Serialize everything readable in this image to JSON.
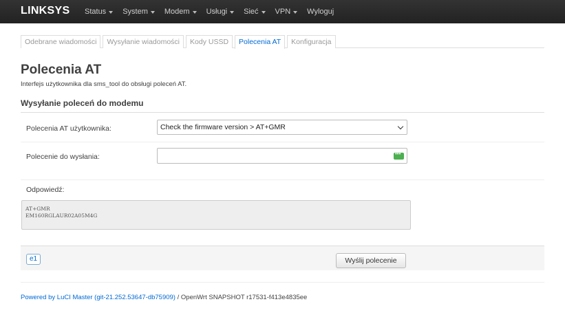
{
  "navbar": {
    "brand": "LINKSYS",
    "menu": [
      {
        "label": "Status",
        "dropdown": true
      },
      {
        "label": "System",
        "dropdown": true
      },
      {
        "label": "Modem",
        "dropdown": true
      },
      {
        "label": "Usługi",
        "dropdown": true
      },
      {
        "label": "Sieć",
        "dropdown": true
      },
      {
        "label": "VPN",
        "dropdown": true
      },
      {
        "label": "Wyloguj",
        "dropdown": false
      }
    ]
  },
  "tabs": [
    {
      "label": "Odebrane wiadomości",
      "active": false
    },
    {
      "label": "Wysyłanie wiadomości",
      "active": false
    },
    {
      "label": "Kody USSD",
      "active": false
    },
    {
      "label": "Polecenia AT",
      "active": true
    },
    {
      "label": "Konfiguracja",
      "active": false
    }
  ],
  "page": {
    "title": "Polecenia AT",
    "description": "Interfejs użytkownika dla sms_tool do obsługi poleceń AT."
  },
  "section": {
    "title": "Wysyłanie poleceń do modemu",
    "user_commands_label": "Polecenia AT użytkownika:",
    "user_commands_selected": "Check the firmware version > AT+GMR",
    "command_label": "Polecenie do wysłania:",
    "command_value": "",
    "response_label": "Odpowiedź:",
    "response_lines": [
      "AT+GMR",
      "EM160RGLAUR02A05M4G"
    ]
  },
  "bottom": {
    "badge": "e1",
    "send_button": "Wyślij polecenie"
  },
  "footer": {
    "link_text": "Powered by LuCI Master (git-21.252.53647-db75909)",
    "rest_text": " / OpenWrt SNAPSHOT r17531-f413e4835ee"
  },
  "colors": {
    "navbar_bg": "#222222",
    "link": "#0069d6",
    "message_icon": "#4caf50"
  }
}
